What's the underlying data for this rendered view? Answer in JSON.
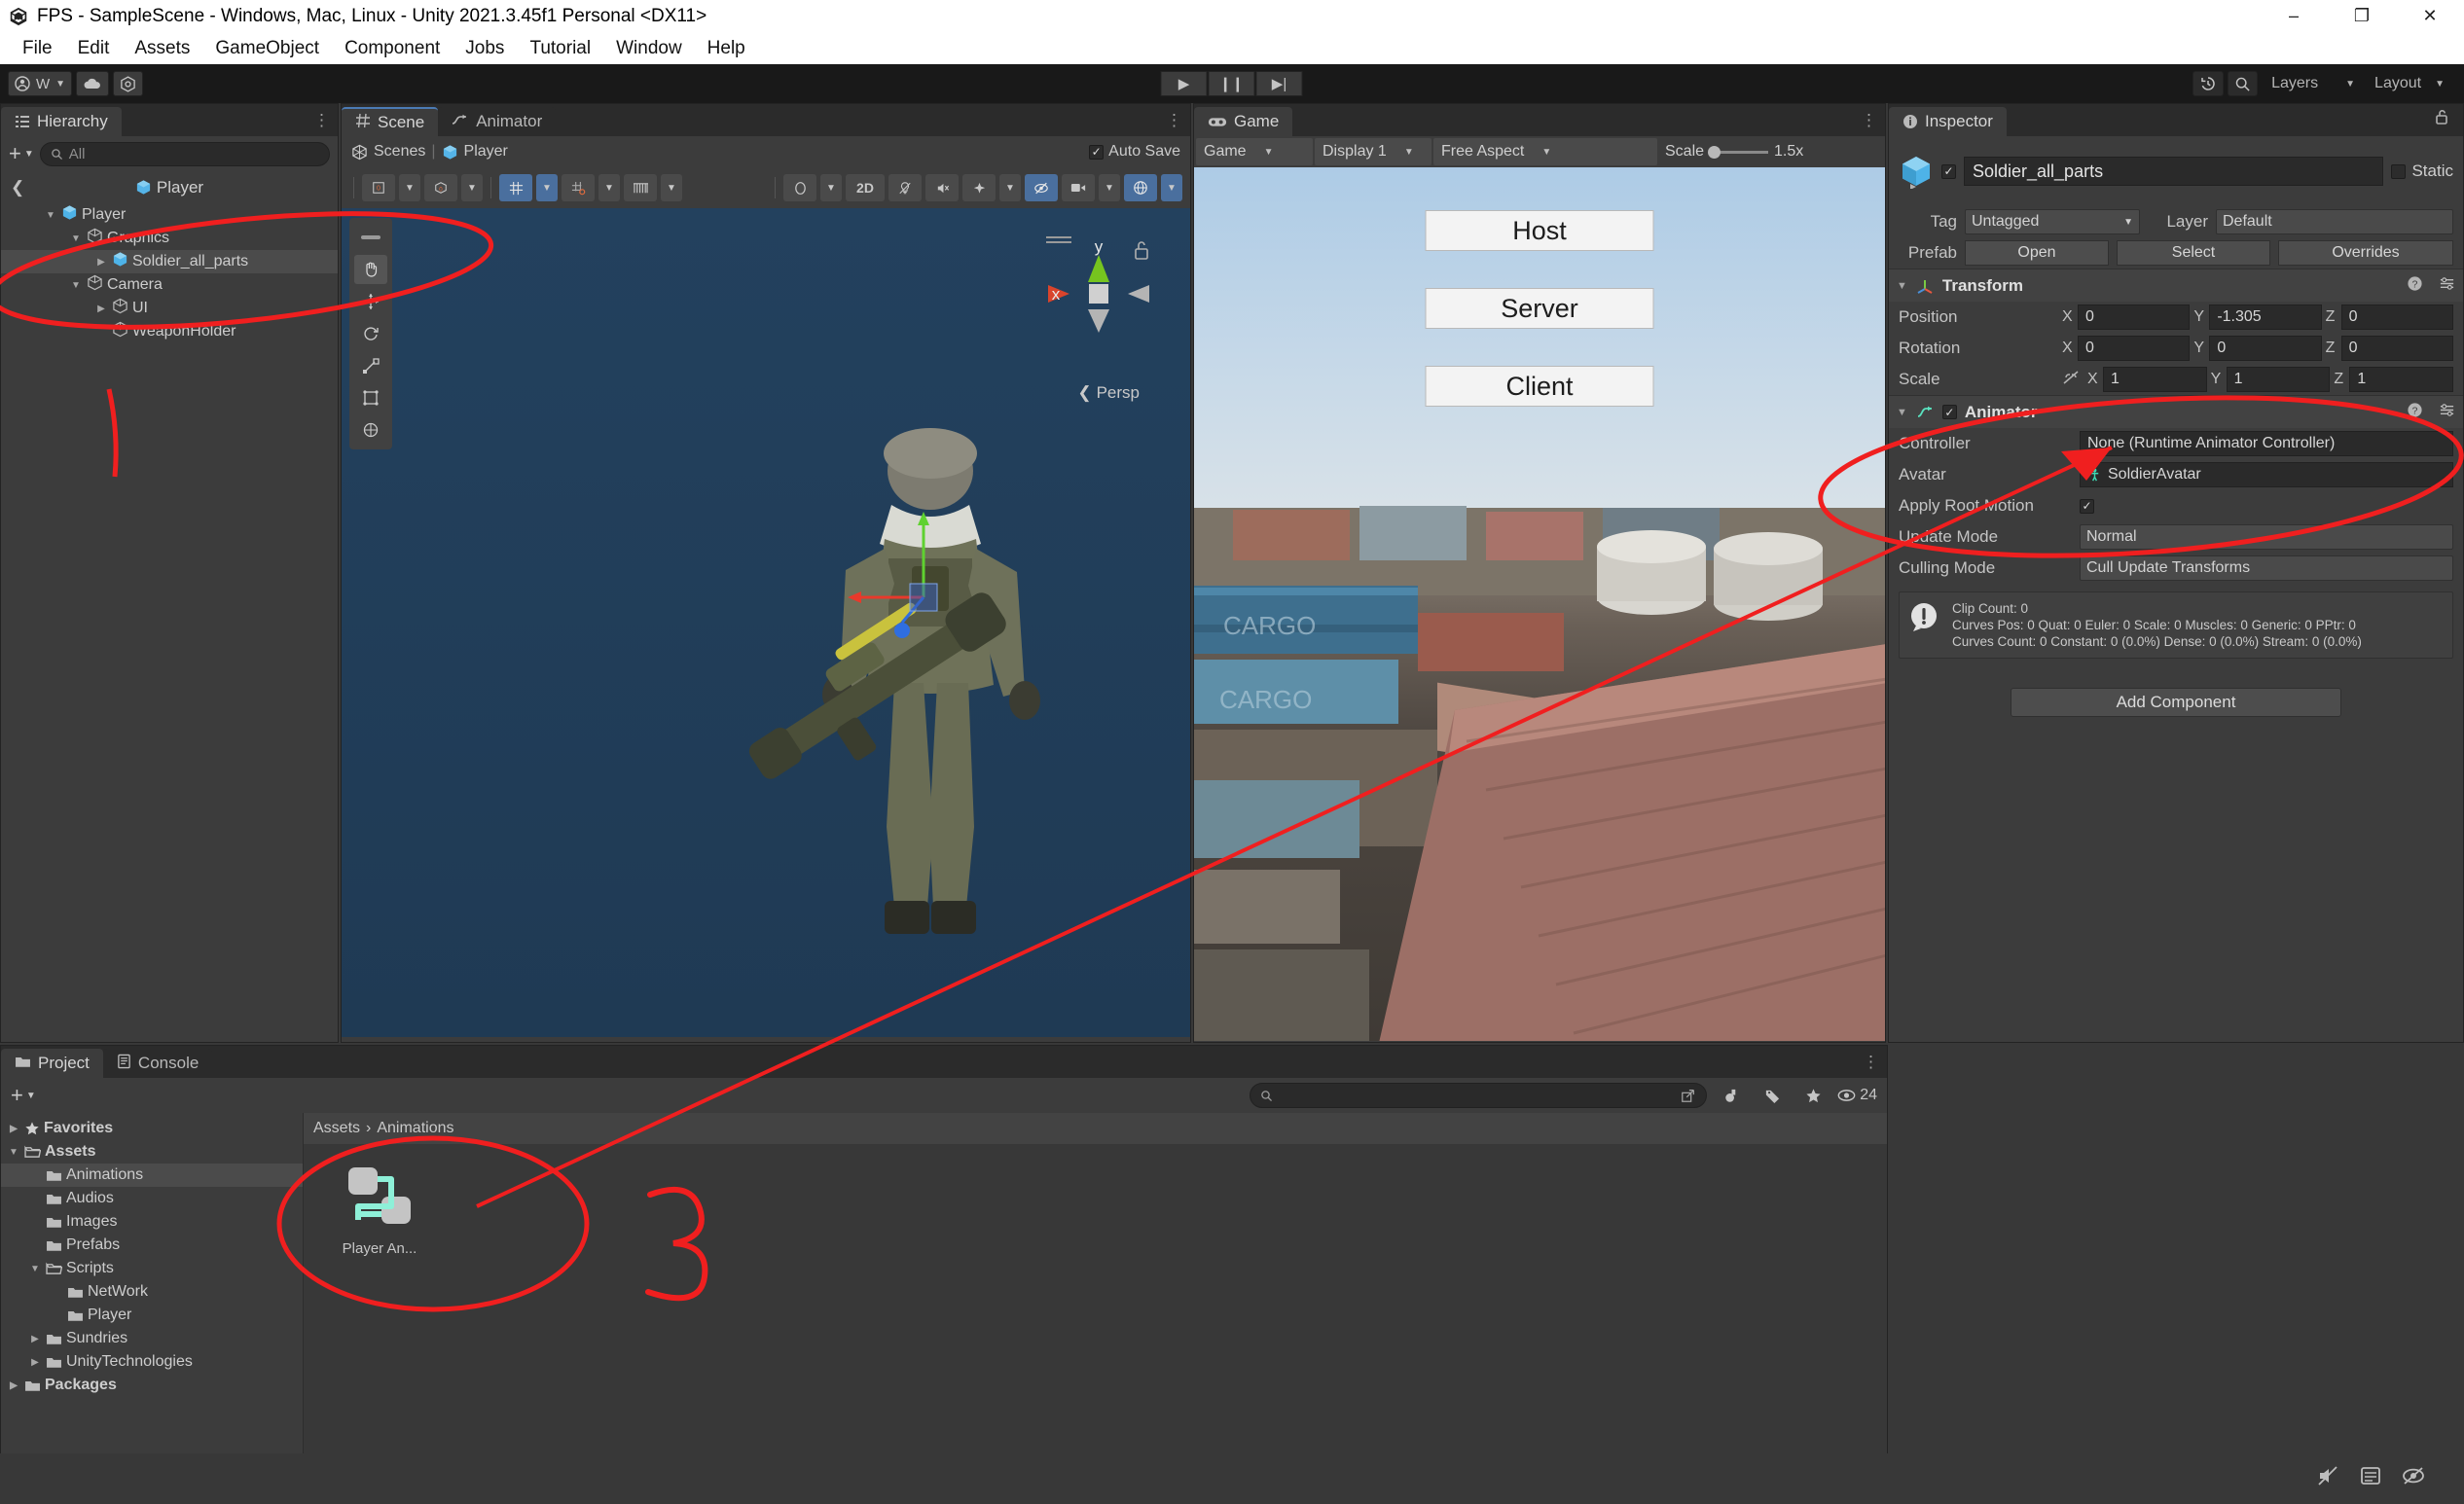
{
  "window": {
    "title": "FPS - SampleScene - Windows, Mac, Linux - Unity 2021.3.45f1 Personal <DX11>",
    "minimize": "–",
    "maximize": "❐",
    "close": "✕"
  },
  "menu": {
    "items": [
      "File",
      "Edit",
      "Assets",
      "GameObject",
      "Component",
      "Jobs",
      "Tutorial",
      "Window",
      "Help"
    ]
  },
  "toolbar": {
    "account_label": "W",
    "play": "▶",
    "pause": "❙❙",
    "step": "▶|",
    "history_icon": "history-icon",
    "search_icon": "search-icon",
    "layers_label": "Layers",
    "layout_label": "Layout"
  },
  "hierarchy": {
    "tab": "Hierarchy",
    "add_label": "+",
    "search_placeholder": "All",
    "breadcrumb": "Player",
    "items": [
      {
        "label": "Player",
        "depth": 1,
        "arrow": "down",
        "icon": "prefab-cube",
        "selected": false
      },
      {
        "label": "Graphics",
        "depth": 2,
        "arrow": "down",
        "icon": "gameobject-cube",
        "selected": false
      },
      {
        "label": "Soldier_all_parts",
        "depth": 3,
        "arrow": "right",
        "icon": "prefab-cube",
        "selected": true
      },
      {
        "label": "Camera",
        "depth": 2,
        "arrow": "down",
        "icon": "gameobject-cube",
        "selected": false
      },
      {
        "label": "UI",
        "depth": 3,
        "arrow": "right",
        "icon": "gameobject-cube",
        "selected": false
      },
      {
        "label": "WeaponHolder",
        "depth": 3,
        "arrow": "none",
        "icon": "gameobject-cube",
        "selected": false
      }
    ]
  },
  "scene": {
    "tabs": [
      {
        "label": "Scene",
        "icon": "grid-icon",
        "active": true
      },
      {
        "label": "Animator",
        "icon": "animator-icon",
        "active": false
      }
    ],
    "breadcrumb_scene": "Scenes",
    "breadcrumb_prefab": "Player",
    "autosave_label": "Auto Save",
    "autosave_checked": true,
    "gizmo_axis_x": "x",
    "gizmo_axis_y": "y",
    "persp_label": "Persp",
    "tool_2d": "2D",
    "left_tools": [
      "hand-tool",
      "move-tool",
      "rotate-tool",
      "scale-tool",
      "rect-tool",
      "transform-tool"
    ]
  },
  "game": {
    "tab": "Game",
    "view_mode": "Game",
    "display": "Display 1",
    "aspect": "Free Aspect",
    "scale_label": "Scale",
    "scale_value": "1.5x",
    "buttons": [
      "Host",
      "Server",
      "Client"
    ]
  },
  "inspector": {
    "tab": "Inspector",
    "object_name": "Soldier_all_parts",
    "enabled": true,
    "static_label": "Static",
    "tag_label": "Tag",
    "tag_value": "Untagged",
    "layer_label": "Layer",
    "layer_value": "Default",
    "prefab_label": "Prefab",
    "prefab_open": "Open",
    "prefab_select": "Select",
    "prefab_overrides": "Overrides",
    "transform": {
      "title": "Transform",
      "rows": [
        {
          "label": "Position",
          "x": "0",
          "y": "-1.305",
          "z": "0"
        },
        {
          "label": "Rotation",
          "x": "0",
          "y": "0",
          "z": "0"
        },
        {
          "label": "Scale",
          "x": "1",
          "y": "1",
          "z": "1"
        }
      ]
    },
    "animator": {
      "title": "Animator",
      "enabled": true,
      "controller_label": "Controller",
      "controller_value": "None (Runtime Animator Controller)",
      "avatar_label": "Avatar",
      "avatar_value": "SoldierAvatar",
      "apply_root_motion_label": "Apply Root Motion",
      "apply_root_motion_checked": true,
      "update_mode_label": "Update Mode",
      "update_mode_value": "Normal",
      "culling_mode_label": "Culling Mode",
      "culling_mode_value": "Cull Update Transforms",
      "info_lines": [
        "Clip Count: 0",
        "Curves Pos: 0 Quat: 0 Euler: 0 Scale: 0 Muscles: 0 Generic: 0 PPtr: 0",
        "Curves Count: 0 Constant: 0 (0.0%) Dense: 0 (0.0%) Stream: 0 (0.0%)"
      ]
    },
    "add_component": "Add Component"
  },
  "project": {
    "tabs": [
      {
        "label": "Project",
        "icon": "folder-icon",
        "active": true
      },
      {
        "label": "Console",
        "icon": "console-icon",
        "active": false
      }
    ],
    "add_label": "+",
    "tree": [
      {
        "label": "Favorites",
        "depth": 0,
        "arrow": "right",
        "icon": "star",
        "bold": true,
        "selected": false
      },
      {
        "label": "Assets",
        "depth": 0,
        "arrow": "down",
        "icon": "folder-open",
        "bold": true,
        "selected": false
      },
      {
        "label": "Animations",
        "depth": 1,
        "arrow": "none",
        "icon": "folder",
        "bold": false,
        "selected": true
      },
      {
        "label": "Audios",
        "depth": 1,
        "arrow": "none",
        "icon": "folder",
        "bold": false,
        "selected": false
      },
      {
        "label": "Images",
        "depth": 1,
        "arrow": "none",
        "icon": "folder",
        "bold": false,
        "selected": false
      },
      {
        "label": "Prefabs",
        "depth": 1,
        "arrow": "none",
        "icon": "folder",
        "bold": false,
        "selected": false
      },
      {
        "label": "Scripts",
        "depth": 1,
        "arrow": "down",
        "icon": "folder-open",
        "bold": false,
        "selected": false
      },
      {
        "label": "NetWork",
        "depth": 2,
        "arrow": "none",
        "icon": "folder",
        "bold": false,
        "selected": false
      },
      {
        "label": "Player",
        "depth": 2,
        "arrow": "none",
        "icon": "folder",
        "bold": false,
        "selected": false
      },
      {
        "label": "Sundries",
        "depth": 1,
        "arrow": "right",
        "icon": "folder",
        "bold": false,
        "selected": false
      },
      {
        "label": "UnityTechnologies",
        "depth": 1,
        "arrow": "right",
        "icon": "folder",
        "bold": false,
        "selected": false
      },
      {
        "label": "Packages",
        "depth": 0,
        "arrow": "right",
        "icon": "folder",
        "bold": true,
        "selected": false
      }
    ],
    "breadcrumb": [
      "Assets",
      "Animations"
    ],
    "breadcrumb_sep": "›",
    "search_placeholder": "",
    "assets": [
      {
        "label": "Player An...",
        "icon": "animator-controller-icon"
      }
    ],
    "visible_count": "24"
  },
  "annotations": {
    "number_marks": [
      "1",
      "3"
    ],
    "color": "#f01f1f"
  }
}
